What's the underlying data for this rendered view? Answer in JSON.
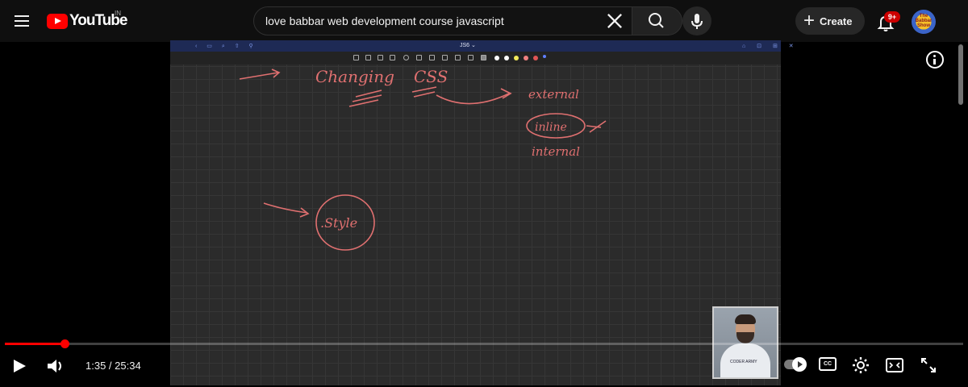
{
  "header": {
    "logo_text": "YouTube",
    "country_code": "IN",
    "search_value": "love babbar web development course javascript",
    "create_label": "Create",
    "notification_count": "9+",
    "avatar_text_top": "The",
    "avatar_text_mid": "Babbar",
    "avatar_text_bottom": "Show"
  },
  "whiteboard": {
    "title": "JS6 ⌄",
    "ink_labels": {
      "heading_1": "Changing",
      "heading_2": "CSS",
      "option_external": "external",
      "option_inline": "inline",
      "option_internal": "internal",
      "style_label": ".Style"
    },
    "ink_color": "#e07070",
    "pen_colors": [
      "#ffffff",
      "#ffffff",
      "#f2e85a",
      "#f08080",
      "#e05555",
      "#6080ff"
    ]
  },
  "player": {
    "time_display": "1:35 / 25:34",
    "progress_fraction": 0.062,
    "cc_label": "CC",
    "pip_logo_text": "CODER ARMY"
  },
  "colors": {
    "background": "#0f0f0f",
    "accent": "#ff0000",
    "badge": "#cc0000"
  }
}
